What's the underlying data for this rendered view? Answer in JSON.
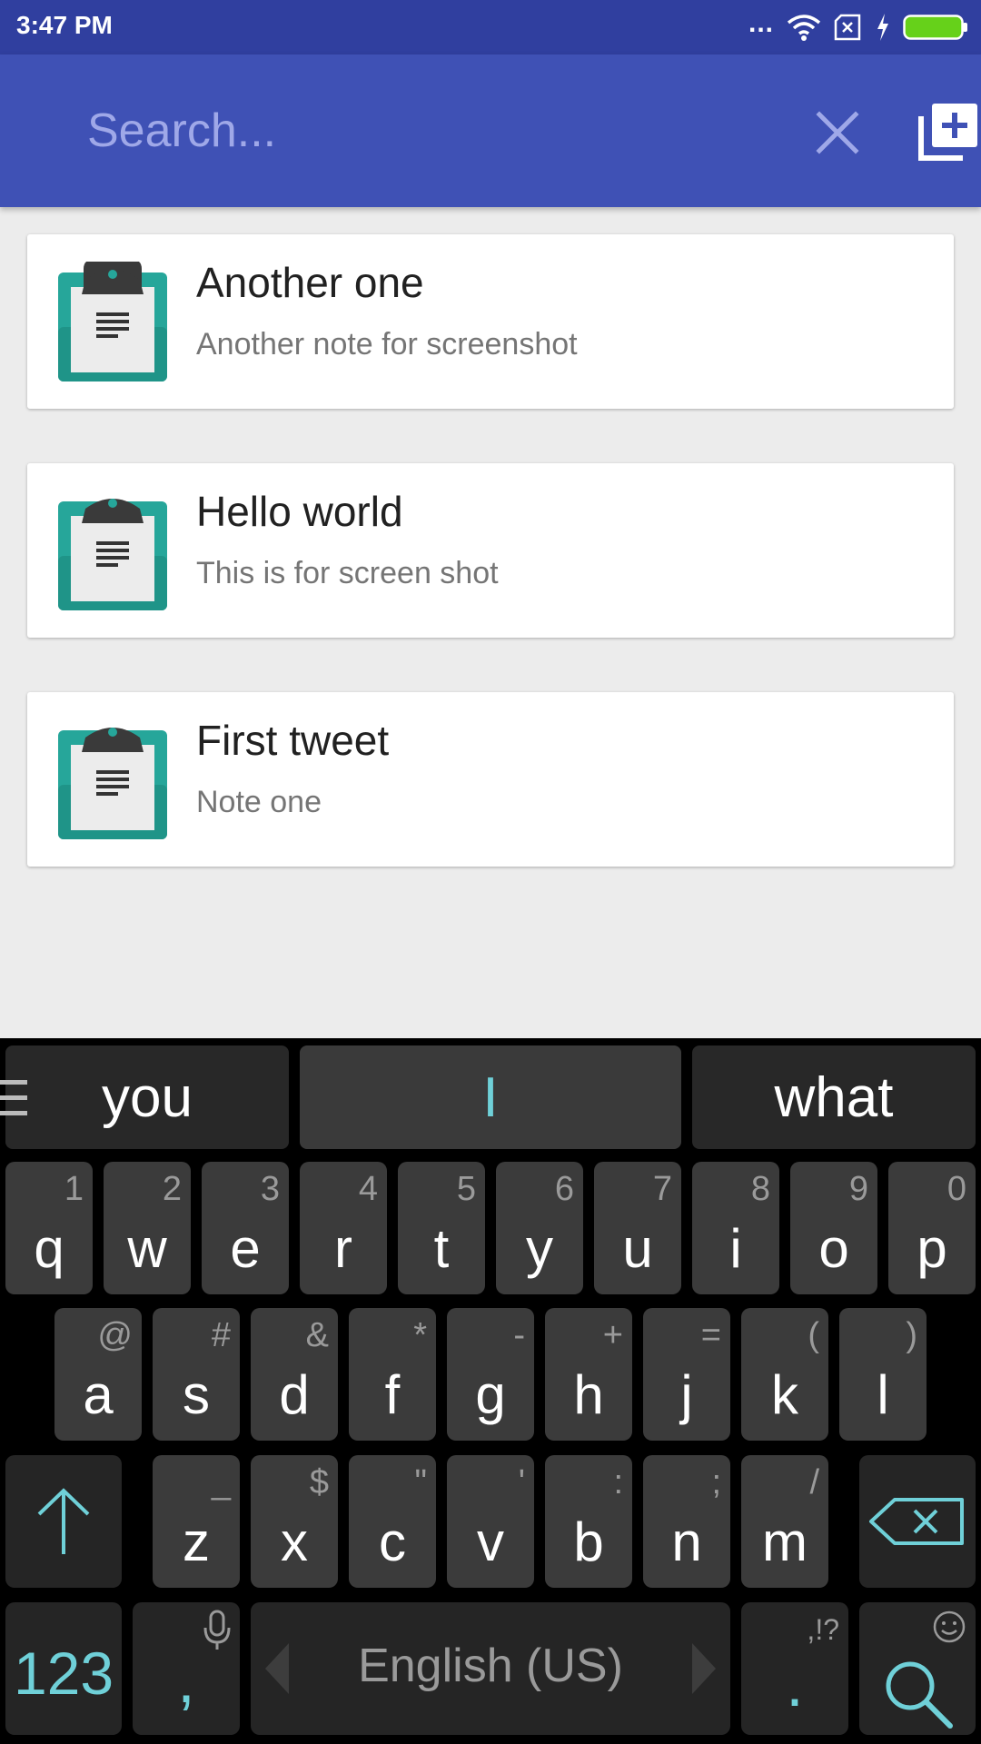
{
  "status_bar": {
    "time": "3:47 PM",
    "dots": "..."
  },
  "search": {
    "placeholder": "Search..."
  },
  "colors": {
    "primary": "#3f51b5",
    "primary_dark": "#303f9f",
    "accent_teal": "#26a69a",
    "keyboard_accent": "#6fd0d8"
  },
  "notes": [
    {
      "title": "Another one",
      "subtitle": "Another note for screenshot",
      "icon": "clipboard-note-icon"
    },
    {
      "title": "Hello world",
      "subtitle": "This is for screen shot",
      "icon": "clipboard-note-icon"
    },
    {
      "title": "First tweet",
      "subtitle": "Note one",
      "icon": "clipboard-note-icon"
    }
  ],
  "keyboard": {
    "suggestions": [
      "you",
      "I",
      "what"
    ],
    "row1": [
      {
        "key": "q",
        "hint": "1"
      },
      {
        "key": "w",
        "hint": "2"
      },
      {
        "key": "e",
        "hint": "3"
      },
      {
        "key": "r",
        "hint": "4"
      },
      {
        "key": "t",
        "hint": "5"
      },
      {
        "key": "y",
        "hint": "6"
      },
      {
        "key": "u",
        "hint": "7"
      },
      {
        "key": "i",
        "hint": "8"
      },
      {
        "key": "o",
        "hint": "9"
      },
      {
        "key": "p",
        "hint": "0"
      }
    ],
    "row2": [
      {
        "key": "a",
        "hint": "@"
      },
      {
        "key": "s",
        "hint": "#"
      },
      {
        "key": "d",
        "hint": "&"
      },
      {
        "key": "f",
        "hint": "*"
      },
      {
        "key": "g",
        "hint": "-"
      },
      {
        "key": "h",
        "hint": "+"
      },
      {
        "key": "j",
        "hint": "="
      },
      {
        "key": "k",
        "hint": "("
      },
      {
        "key": "l",
        "hint": ")"
      }
    ],
    "row3": [
      {
        "key": "z",
        "hint": "_"
      },
      {
        "key": "x",
        "hint": "$"
      },
      {
        "key": "c",
        "hint": "\""
      },
      {
        "key": "v",
        "hint": "'"
      },
      {
        "key": "b",
        "hint": ":"
      },
      {
        "key": "n",
        "hint": ";"
      },
      {
        "key": "m",
        "hint": "/"
      }
    ],
    "symbols_key": "123",
    "comma_key": ",",
    "space_label": "English (US)",
    "period_key": ".",
    "period_hint": ",!?"
  }
}
